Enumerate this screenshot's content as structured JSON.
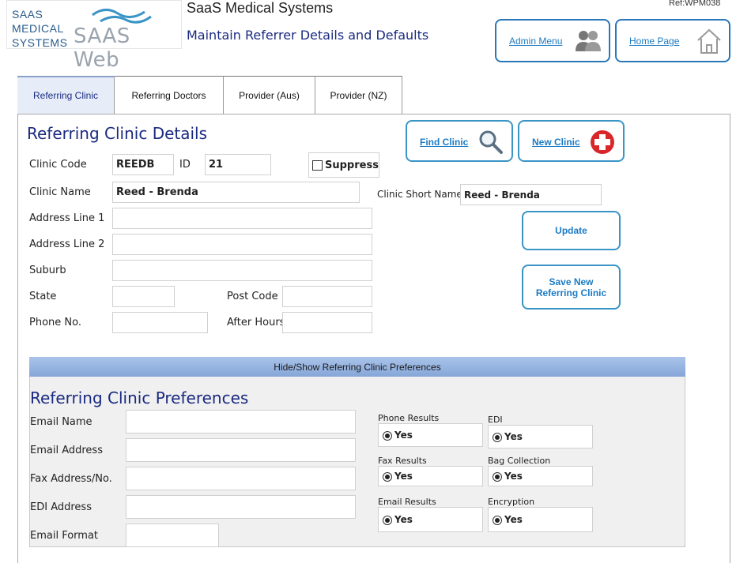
{
  "header": {
    "logo_small_lines": [
      "SAAS",
      "MEDICAL",
      "SYSTEMS"
    ],
    "logo_big": "SAAS Web",
    "app_title": "SaaS Medical Systems",
    "page_title": "Maintain Referrer Details and Defaults",
    "ref_code": "Ref:WPM038"
  },
  "nav": {
    "admin_menu": "Admin Menu",
    "home_page": "Home Page"
  },
  "tabs": [
    {
      "label": "Referring Clinic",
      "active": true
    },
    {
      "label": "Referring Doctors",
      "active": false
    },
    {
      "label": "Provider (Aus)",
      "active": false
    },
    {
      "label": "Provider (NZ)",
      "active": false
    }
  ],
  "details": {
    "title": "Referring Clinic Details",
    "clinic_code_label": "Clinic Code",
    "clinic_code": "REEDB",
    "id_label": "ID",
    "id_value": "21",
    "suppress_label": "Suppress",
    "suppress_checked": false,
    "clinic_name_label": "Clinic Name",
    "clinic_name": "Reed - Brenda",
    "clinic_short_name_label": "Clinic Short Name",
    "clinic_short_name": "Reed - Brenda",
    "address1_label": "Address Line 1",
    "address1": "",
    "address2_label": "Address Line 2",
    "address2": "",
    "suburb_label": "Suburb",
    "suburb": "",
    "state_label": "State",
    "state": "",
    "postcode_label": "Post Code",
    "postcode": "",
    "phone_label": "Phone No.",
    "phone": "",
    "afterhours_label": "After Hours",
    "afterhours": ""
  },
  "actions": {
    "find_clinic": "Find Clinic",
    "new_clinic": "New Clinic",
    "update": "Update",
    "save_new_line1": "Save New",
    "save_new_line2": "Referring Clinic"
  },
  "preferences": {
    "toggle_bar": "Hide/Show Referring Clinic Preferences",
    "title": "Referring Clinic Preferences",
    "email_name_label": "Email Name",
    "email_address_label": "Email Address",
    "fax_label": "Fax Address/No.",
    "edi_address_label": "EDI Address",
    "email_format_label": "Email Format",
    "phone_results_label": "Phone Results",
    "phone_results": "Yes",
    "edi_label": "EDI",
    "edi": "Yes",
    "fax_results_label": "Fax Results",
    "fax_results": "Yes",
    "bag_collection_label": "Bag Collection",
    "bag_collection": "Yes",
    "email_results_label": "Email Results",
    "email_results": "Yes",
    "encryption_label": "Encryption",
    "encryption": "Yes"
  },
  "colors": {
    "accent": "#1a2a80",
    "button_border": "#3a95c6",
    "link": "#1c7bc4",
    "new_clinic_icon": "#d9262b"
  },
  "icons": [
    "admin-users-icon",
    "home-icon",
    "search-icon",
    "medical-cross-icon",
    "logo-wave-icon"
  ]
}
